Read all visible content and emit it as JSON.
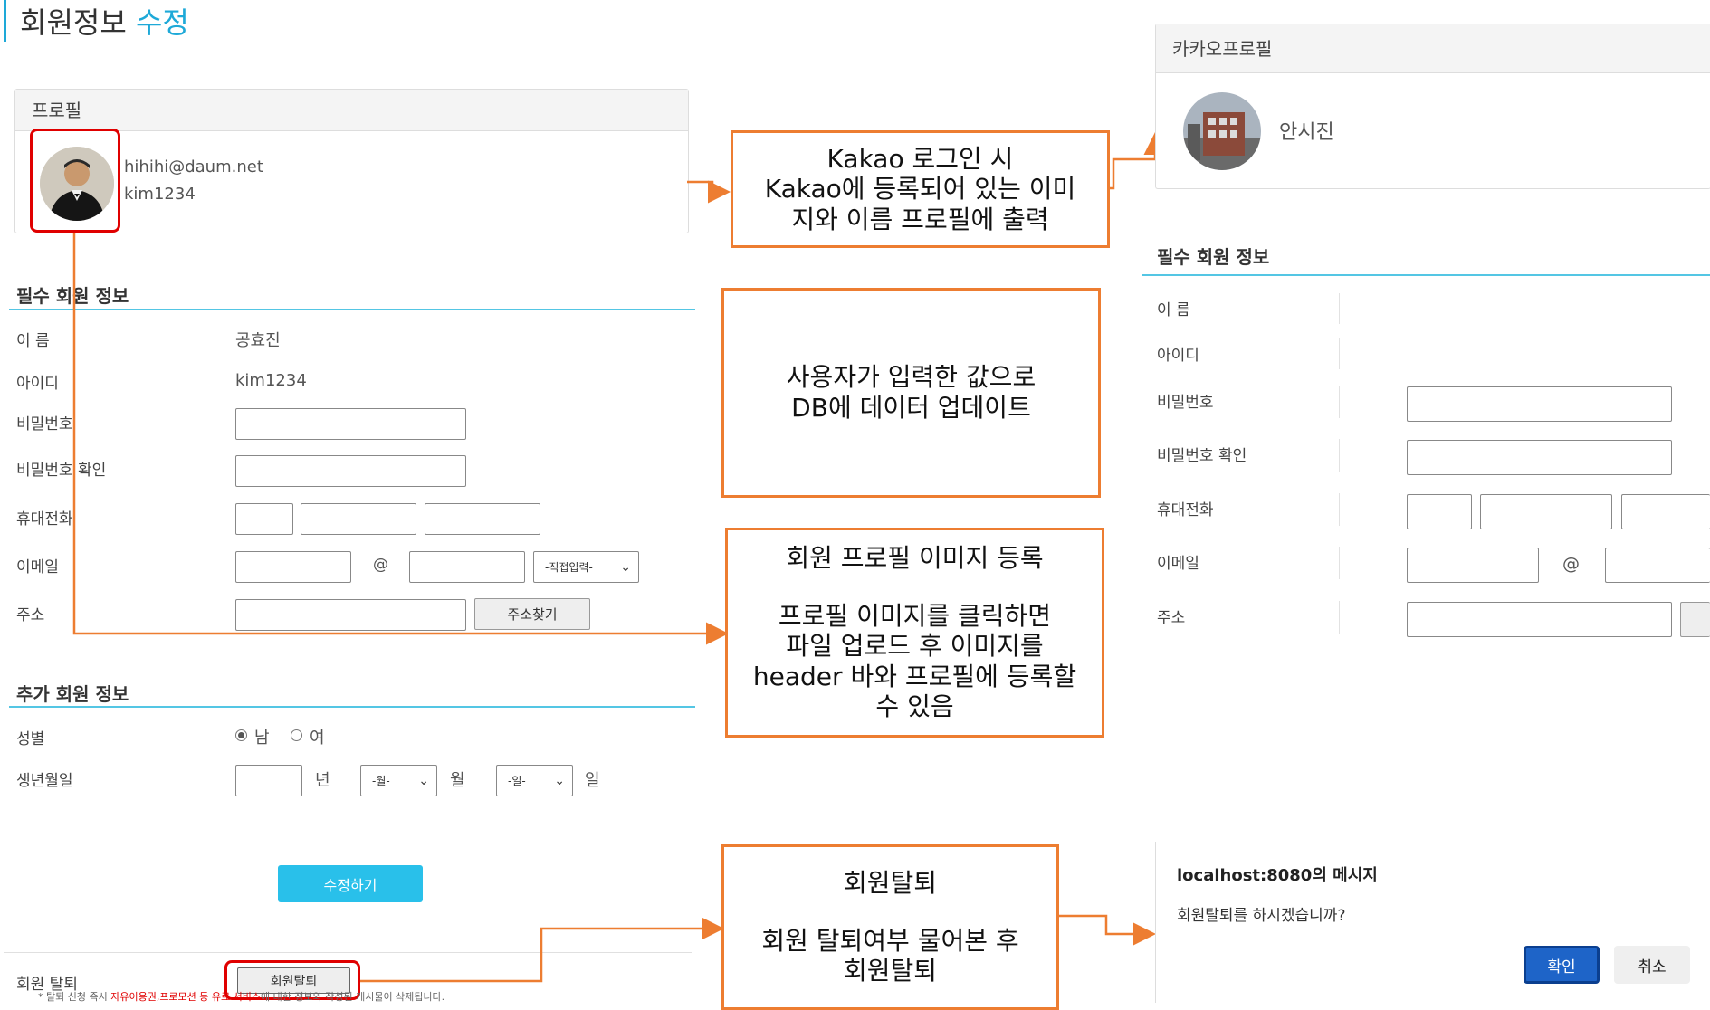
{
  "header": {
    "title_main": "회원정보",
    "title_accent": "수정"
  },
  "profile": {
    "head": "프로필",
    "email": "hihihi@daum.net",
    "id": "kim1234"
  },
  "required": {
    "title": "필수 회원 정보",
    "name_label": "이 름",
    "name_value": "공효진",
    "id_label": "아이디",
    "id_value": "kim1234",
    "pw_label": "비밀번호",
    "pw_confirm_label": "비밀번호 확인",
    "phone_label": "휴대전화",
    "email_label": "이메일",
    "email_at": "@",
    "email_domain_select": "-직접입력-",
    "address_label": "주소",
    "address_button": "주소찾기"
  },
  "additional": {
    "title": "추가 회원 정보",
    "gender_label": "성별",
    "gender_male": "남",
    "gender_female": "여",
    "gender_selected": "남",
    "birth_label": "생년월일",
    "year_unit": "년",
    "month_select": "-월-",
    "month_unit": "월",
    "day_select": "-일-",
    "day_unit": "일"
  },
  "submit_button": "수정하기",
  "withdraw": {
    "label": "회원 탈퇴",
    "button": "회원탈퇴",
    "notice_prefix": "* 탈퇴 신청 즉시 ",
    "notice_red": "자유이용권,프로모션 등 유료 서비스",
    "notice_suffix": "에 대한 정보와 작성된 게시물이 삭제됩니다."
  },
  "kakao": {
    "head": "카카오프로필",
    "name": "안시진",
    "required_title": "필수 회원 정보",
    "name_label": "이 름",
    "id_label": "아이디",
    "pw_label": "비밀번호",
    "pw_confirm_label": "비밀번호 확인",
    "phone_label": "휴대전화",
    "email_label": "이메일",
    "email_at": "@",
    "address_label": "주소"
  },
  "dialog": {
    "title": "localhost:8080의 메시지",
    "message": "회원탈퇴를 하시겠습니까?",
    "ok": "확인",
    "cancel": "취소"
  },
  "annotations": {
    "kakao_login": [
      "Kakao 로그인 시",
      "Kakao에 등록되어 있는 이미",
      "지와 이름 프로필에 출력"
    ],
    "update": [
      "사용자가 입력한 값으로",
      "DB에 데이터 업데이트"
    ],
    "profile_image_title": "회원 프로필 이미지 등록",
    "profile_image_body": [
      "프로필 이미지를 클릭하면",
      "파일 업로드 후 이미지를",
      "header 바와 프로필에 등록할",
      "수 있음"
    ],
    "withdraw_title": "회원탈퇴",
    "withdraw_body": [
      "회원 탈퇴여부 물어본 후",
      "회원탈퇴"
    ]
  },
  "colors": {
    "accent": "#1ea9d8",
    "annotation": "#ed7d31",
    "highlight": "#e00000",
    "submit": "#29c0ea",
    "dialog_ok": "#1e64c8"
  },
  "icons": {
    "avatar": "avatar-photo",
    "kakao_avatar": "building-photo",
    "dropdown": "chevron-down-icon"
  }
}
